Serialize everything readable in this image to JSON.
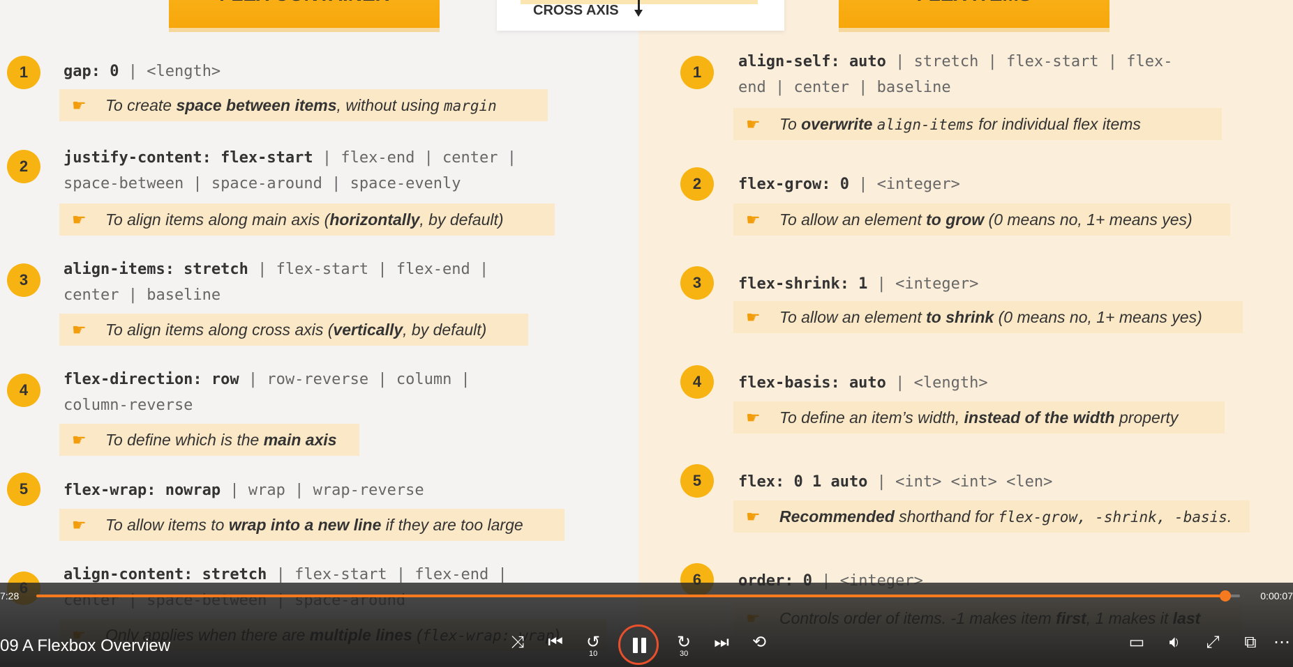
{
  "slide": {
    "left_header": "FLEX CONTAINER",
    "right_header": "FLEX ITEMS",
    "axis_label": "CROSS AXIS",
    "left_items": [
      {
        "num": "1",
        "prop": "gap: 0",
        "alts": " | <length>",
        "line2": "",
        "note_pre": "To create ",
        "note_bold": "space between items",
        "note_mid": ", without using ",
        "note_code": "margin",
        "note_post": ""
      },
      {
        "num": "2",
        "prop": "justify-content: flex-start",
        "alts": " | flex-end | center |",
        "line2": "space-between | space-around | space-evenly",
        "note_pre": "To align items along main axis (",
        "note_bold": "horizontally",
        "note_mid": ", by default)",
        "note_code": "",
        "note_post": ""
      },
      {
        "num": "3",
        "prop": "align-items: stretch",
        "alts": " | flex-start | flex-end |",
        "line2": "center | baseline",
        "note_pre": "To align items along cross axis (",
        "note_bold": "vertically",
        "note_mid": ", by default)",
        "note_code": "",
        "note_post": ""
      },
      {
        "num": "4",
        "prop": "flex-direction: row",
        "alts": " | row-reverse | column |",
        "line2": "column-reverse",
        "note_pre": "To define which is the ",
        "note_bold": "main axis",
        "note_mid": "",
        "note_code": "",
        "note_post": ""
      },
      {
        "num": "5",
        "prop": "flex-wrap: nowrap",
        "alts": " | wrap | wrap-reverse",
        "line2": "",
        "note_pre": "To allow items to ",
        "note_bold": "wrap into a new line",
        "note_mid": " if they are too large",
        "note_code": "",
        "note_post": ""
      },
      {
        "num": "6",
        "prop": "align-content: stretch",
        "alts": " | flex-start | flex-end |",
        "line2": "center | space-between | space-around",
        "note_pre": "Only applies when there are ",
        "note_bold": "multiple lines",
        "note_mid": " (",
        "note_code": "flex-wrap: wrap",
        "note_post": ")"
      }
    ],
    "right_items": [
      {
        "num": "1",
        "prop": "align-self: auto",
        "alts": " | stretch | flex-start | flex-",
        "line2": "end | center | baseline",
        "note_pre": "To ",
        "note_bold": "overwrite",
        "note_mid": " ",
        "note_code": "align-items",
        "note_post": " for individual flex items"
      },
      {
        "num": "2",
        "prop": "flex-grow: 0",
        "alts": " | <integer>",
        "line2": "",
        "note_pre": "To allow an element ",
        "note_bold": "to grow",
        "note_mid": " (0 means no, 1+ means yes)",
        "note_code": "",
        "note_post": ""
      },
      {
        "num": "3",
        "prop": "flex-shrink: 1",
        "alts": " | <integer>",
        "line2": "",
        "note_pre": "To allow an element ",
        "note_bold": "to shrink",
        "note_mid": " (0 means no, 1+ means yes)",
        "note_code": "",
        "note_post": ""
      },
      {
        "num": "4",
        "prop": "flex-basis: auto",
        "alts": " | <length>",
        "line2": "",
        "note_pre": "To define an item’s width, ",
        "note_bold": "instead of the width",
        "note_mid": " property",
        "note_code": "",
        "note_post": ""
      },
      {
        "num": "5",
        "prop": "flex: 0 1 auto",
        "alts": " | <int> <int> <len>",
        "line2": "",
        "note_pre": "",
        "note_bold": "Recommended",
        "note_mid": " shorthand for ",
        "note_code": "flex-grow, -shrink, -basis",
        "note_post": "."
      },
      {
        "num": "6",
        "prop": "order: 0",
        "alts": " | <integer>",
        "line2": "",
        "note_pre": "Controls order of items. -1 makes item ",
        "note_bold": "first",
        "note_mid": ", 1 makes it ",
        "note_code": "",
        "note_post": "last"
      }
    ]
  },
  "player": {
    "elapsed": "7:28",
    "remaining": "0:00:07",
    "progress": 0.988,
    "title": "09 A Flexbox Overview",
    "accent": "#f77a1f"
  }
}
